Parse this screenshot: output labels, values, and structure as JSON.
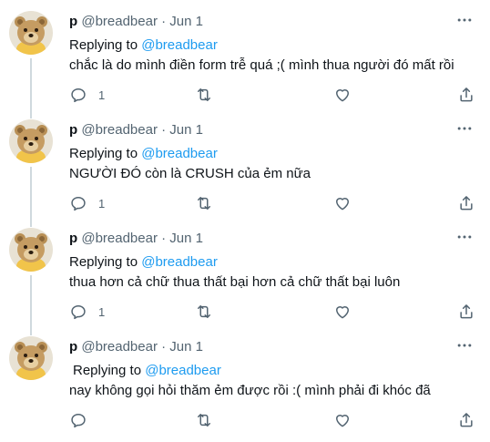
{
  "user": {
    "display_name": "p",
    "handle": "@breadbear"
  },
  "reply_prefix": "Replying to",
  "tweets": [
    {
      "date": "· Jun 1",
      "reply_to": "@breadbear",
      "text": "chắc là do mình điền form trễ quá ;( mình thua người đó mất rồi",
      "reply_count": "1"
    },
    {
      "date": "· Jun 1",
      "reply_to": "@breadbear",
      "text": "NGƯỜI ĐÓ còn là CRUSH của ẻm nữa",
      "reply_count": "1"
    },
    {
      "date": "· Jun 1",
      "reply_to": "@breadbear",
      "text": "thua hơn cả chữ thua thất bại hơn cả chữ thất bại luôn",
      "reply_count": "1"
    },
    {
      "date": "· Jun 1",
      "reply_to": "@breadbear",
      "text": "nay không gọi hỏi thăm ẻm được rồi :( mình phải đi khóc đã",
      "reply_count": ""
    }
  ],
  "colors": {
    "link": "#1d9bf0",
    "muted": "#536471",
    "thread_line": "#cfd9de"
  },
  "icons": [
    "more-icon",
    "reply-icon",
    "retweet-icon",
    "like-icon",
    "share-icon"
  ]
}
